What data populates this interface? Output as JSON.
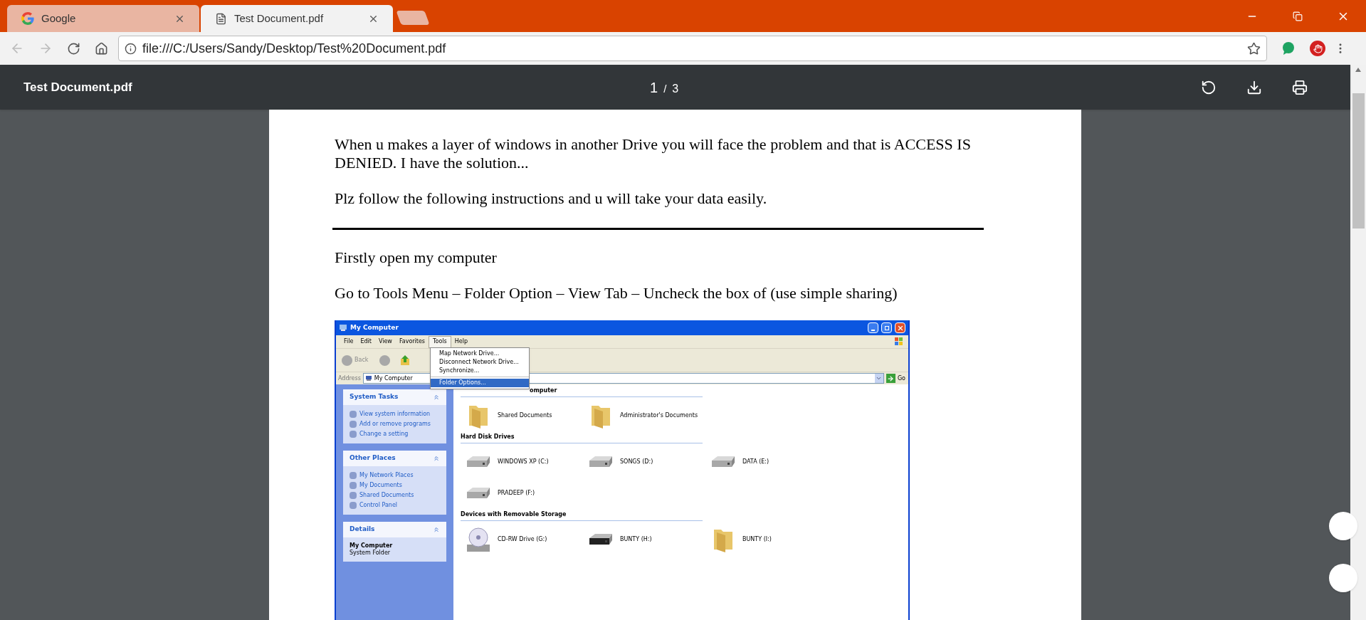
{
  "browser": {
    "tabs": [
      {
        "title": "Google",
        "selected": false
      },
      {
        "title": "Test Document.pdf",
        "selected": true
      }
    ],
    "address": "file:///C:/Users/Sandy/Desktop/Test%20Document.pdf"
  },
  "pdf_toolbar": {
    "title": "Test Document.pdf",
    "page": "1",
    "separator": "/",
    "total": "3"
  },
  "document": {
    "intro": [
      "When u makes a layer of windows in another Drive you will face the problem and that is ACCESS IS DENIED. I have the solution...",
      "Plz follow the following instructions and u will take your data easily."
    ],
    "steps": [
      "Firstly open my computer",
      "Go to Tools Menu – Folder Option – View Tab – Uncheck the box of (use simple sharing)"
    ],
    "screenshot": {
      "title": "My Computer",
      "menu": [
        {
          "label": "File",
          "selected": false
        },
        {
          "label": "Edit",
          "selected": false
        },
        {
          "label": "View",
          "selected": false
        },
        {
          "label": "Favorites",
          "selected": false
        },
        {
          "label": "Tools",
          "selected": true
        },
        {
          "label": "Help",
          "selected": false
        }
      ],
      "back": "Back",
      "address_label": "Address",
      "address": "My Computer",
      "go": "Go",
      "dropdown": [
        {
          "label": "Map Network Drive...",
          "selected": false
        },
        {
          "label": "Disconnect Network Drive...",
          "selected": false
        },
        {
          "label": "Synchronize...",
          "selected": false
        },
        {
          "label": "Folder Options...",
          "selected": true
        }
      ],
      "panels": [
        {
          "title": "System Tasks",
          "items": [
            "View system information",
            "Add or remove programs",
            "Change a setting"
          ]
        },
        {
          "title": "Other Places",
          "items": [
            "My Network Places",
            "My Documents",
            "Shared Documents",
            "Control Panel"
          ]
        }
      ],
      "details": {
        "title": "Details",
        "name": "My Computer",
        "subtitle": "System Folder"
      },
      "groups": [
        {
          "header": "omputer",
          "items": [
            {
              "label": "Shared Documents",
              "kind": "folder"
            },
            {
              "label": "Administrator's Documents",
              "kind": "folder"
            }
          ]
        },
        {
          "header": "Hard Disk Drives",
          "items": [
            {
              "label": "WINDOWS XP (C:)",
              "kind": "drive"
            },
            {
              "label": "SONGS (D:)",
              "kind": "drive"
            },
            {
              "label": "DATA (E:)",
              "kind": "drive"
            },
            {
              "label": "PRADEEP (F:)",
              "kind": "drive"
            }
          ]
        },
        {
          "header": "Devices with Removable Storage",
          "items": [
            {
              "label": "CD-RW Drive (G:)",
              "kind": "cd"
            },
            {
              "label": "BUNTY (H:)",
              "kind": "removable"
            },
            {
              "label": "BUNTY (I:)",
              "kind": "folder"
            }
          ]
        }
      ]
    }
  }
}
